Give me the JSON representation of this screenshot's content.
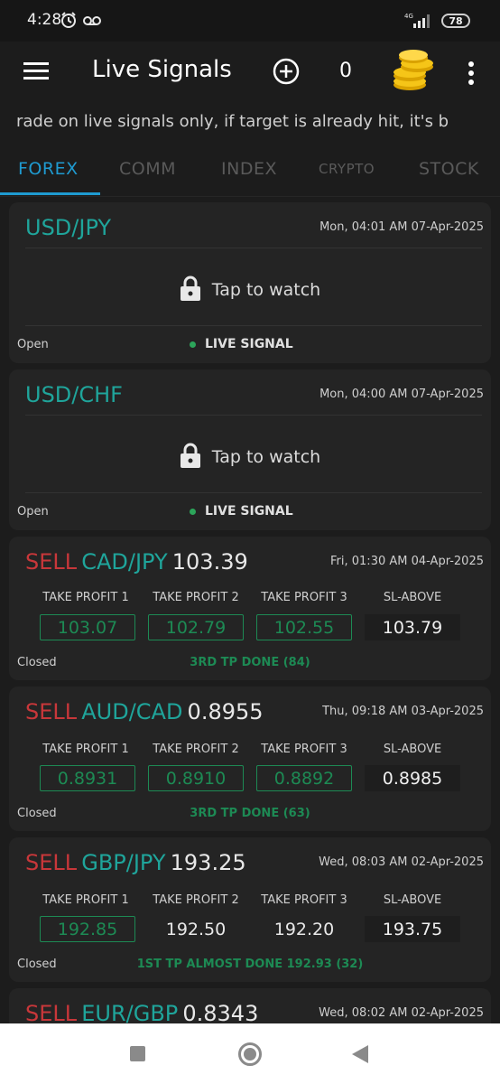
{
  "status_bar": {
    "time": "4:28",
    "battery": "78",
    "network": "4G"
  },
  "app_bar": {
    "title": "Live Signals",
    "coin_count": "0"
  },
  "ticker": "rade on live signals only, if target is already hit, it's b",
  "tabs": [
    "FOREX",
    "COMM",
    "INDEX",
    "CRYPTO",
    "STOCK"
  ],
  "active_tab": "FOREX",
  "locked_cards": [
    {
      "pair": "USD/JPY",
      "date": "Mon, 04:01 AM 07-Apr-2025",
      "lock_text": "Tap to watch",
      "status": "Open",
      "live_label": "LIVE SIGNAL"
    },
    {
      "pair": "USD/CHF",
      "date": "Mon, 04:00 AM 07-Apr-2025",
      "lock_text": "Tap to watch",
      "status": "Open",
      "live_label": "LIVE SIGNAL"
    }
  ],
  "labels": {
    "tp1": "TAKE PROFIT 1",
    "tp2": "TAKE PROFIT 2",
    "tp3": "TAKE PROFIT 3",
    "sl": "SL-ABOVE"
  },
  "signal_cards": [
    {
      "action": "SELL",
      "pair": "CAD/JPY",
      "price": "103.39",
      "date": "Fri, 01:30 AM 04-Apr-2025",
      "tp1": "103.07",
      "tp2": "102.79",
      "tp3": "102.55",
      "sl": "103.79",
      "status": "Closed",
      "result": "3RD TP DONE (84)"
    },
    {
      "action": "SELL",
      "pair": "AUD/CAD",
      "price": "0.8955",
      "date": "Thu, 09:18 AM 03-Apr-2025",
      "tp1": "0.8931",
      "tp2": "0.8910",
      "tp3": "0.8892",
      "sl": "0.8985",
      "status": "Closed",
      "result": "3RD TP DONE (63)"
    },
    {
      "action": "SELL",
      "pair": "GBP/JPY",
      "price": "193.25",
      "date": "Wed, 08:03 AM 02-Apr-2025",
      "tp1": "192.85",
      "tp2": "192.50",
      "tp3": "192.20",
      "sl": "193.75",
      "status": "Closed",
      "result": "1ST TP ALMOST DONE 192.93 (32)"
    },
    {
      "action": "SELL",
      "pair": "EUR/GBP",
      "price": "0.8343",
      "date": "Wed, 08:02 AM 02-Apr-2025"
    }
  ],
  "colors": {
    "accent": "#1f9bd1",
    "pair": "#1fa59b",
    "sell": "#c8373a",
    "hit": "#1d8a54",
    "background": "#1c1c1c",
    "card": "#242424"
  }
}
